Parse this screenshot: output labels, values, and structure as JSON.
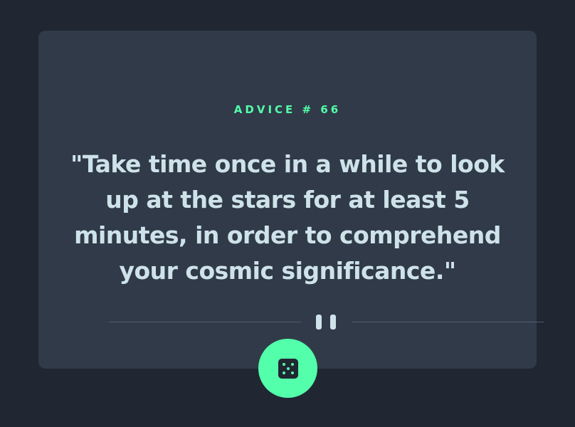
{
  "advice": {
    "label": "ADVICE # 66",
    "quote": "\"Take time once in a while to look up at the stars for at least 5 minutes, in order to comprehend your cosmic significance.\""
  },
  "icons": {
    "divider": "pause-icon",
    "generate": "dice-icon"
  },
  "colors": {
    "background": "#202632",
    "card": "#313a48",
    "accent": "#53ffaa",
    "text": "#cee3e9",
    "divider": "#4f5d74"
  }
}
